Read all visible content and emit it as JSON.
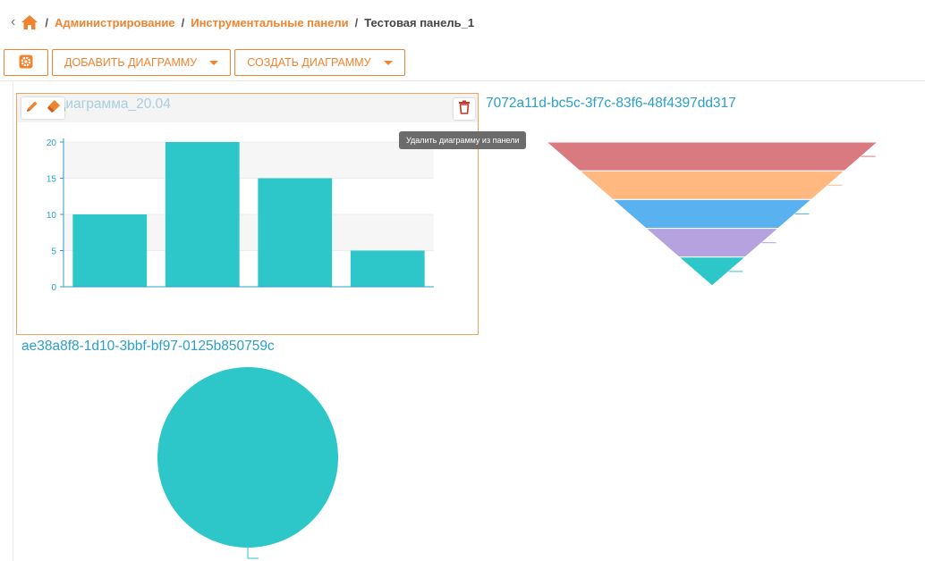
{
  "breadcrumb": {
    "items": [
      "Администрирование",
      "Инструментальные панели"
    ],
    "current": "Тестовая панель_1"
  },
  "toolbar": {
    "add_chart_label": "ДОБАВИТЬ ДИАГРАММУ",
    "create_chart_label": "СОЗДАТЬ ДИАГРАММУ"
  },
  "colors": {
    "accent": "#f0832f",
    "link": "#2a9fc9",
    "teal": "#2ec7c9",
    "funnel": [
      "#d87a80",
      "#ffb980",
      "#5ab1ef",
      "#b6a2de",
      "#2ec7c9"
    ]
  },
  "icons": [
    "home-icon",
    "settings-icon",
    "edit-icon",
    "eraser-icon",
    "delete-icon"
  ],
  "panels": [
    {
      "title": "ая диаграмма_20.04",
      "tooltip": "Удалить диаграмму из панели"
    },
    {
      "title": "7072a11d-bc5c-3f7c-83f6-48f4397dd317"
    },
    {
      "title": "ae38a8f8-1d10-3bbf-bf97-0125b850759c"
    }
  ],
  "chart_data": [
    {
      "type": "bar",
      "categories": [
        "",
        "",
        "",
        ""
      ],
      "values": [
        10,
        20,
        15,
        5
      ],
      "ylim": [
        0,
        20
      ],
      "yticks": [
        0,
        5,
        10,
        15,
        20
      ],
      "grid": true
    },
    {
      "type": "funnel",
      "values": [
        100,
        80,
        60,
        40,
        20
      ]
    },
    {
      "type": "pie",
      "values": [
        100
      ]
    }
  ]
}
